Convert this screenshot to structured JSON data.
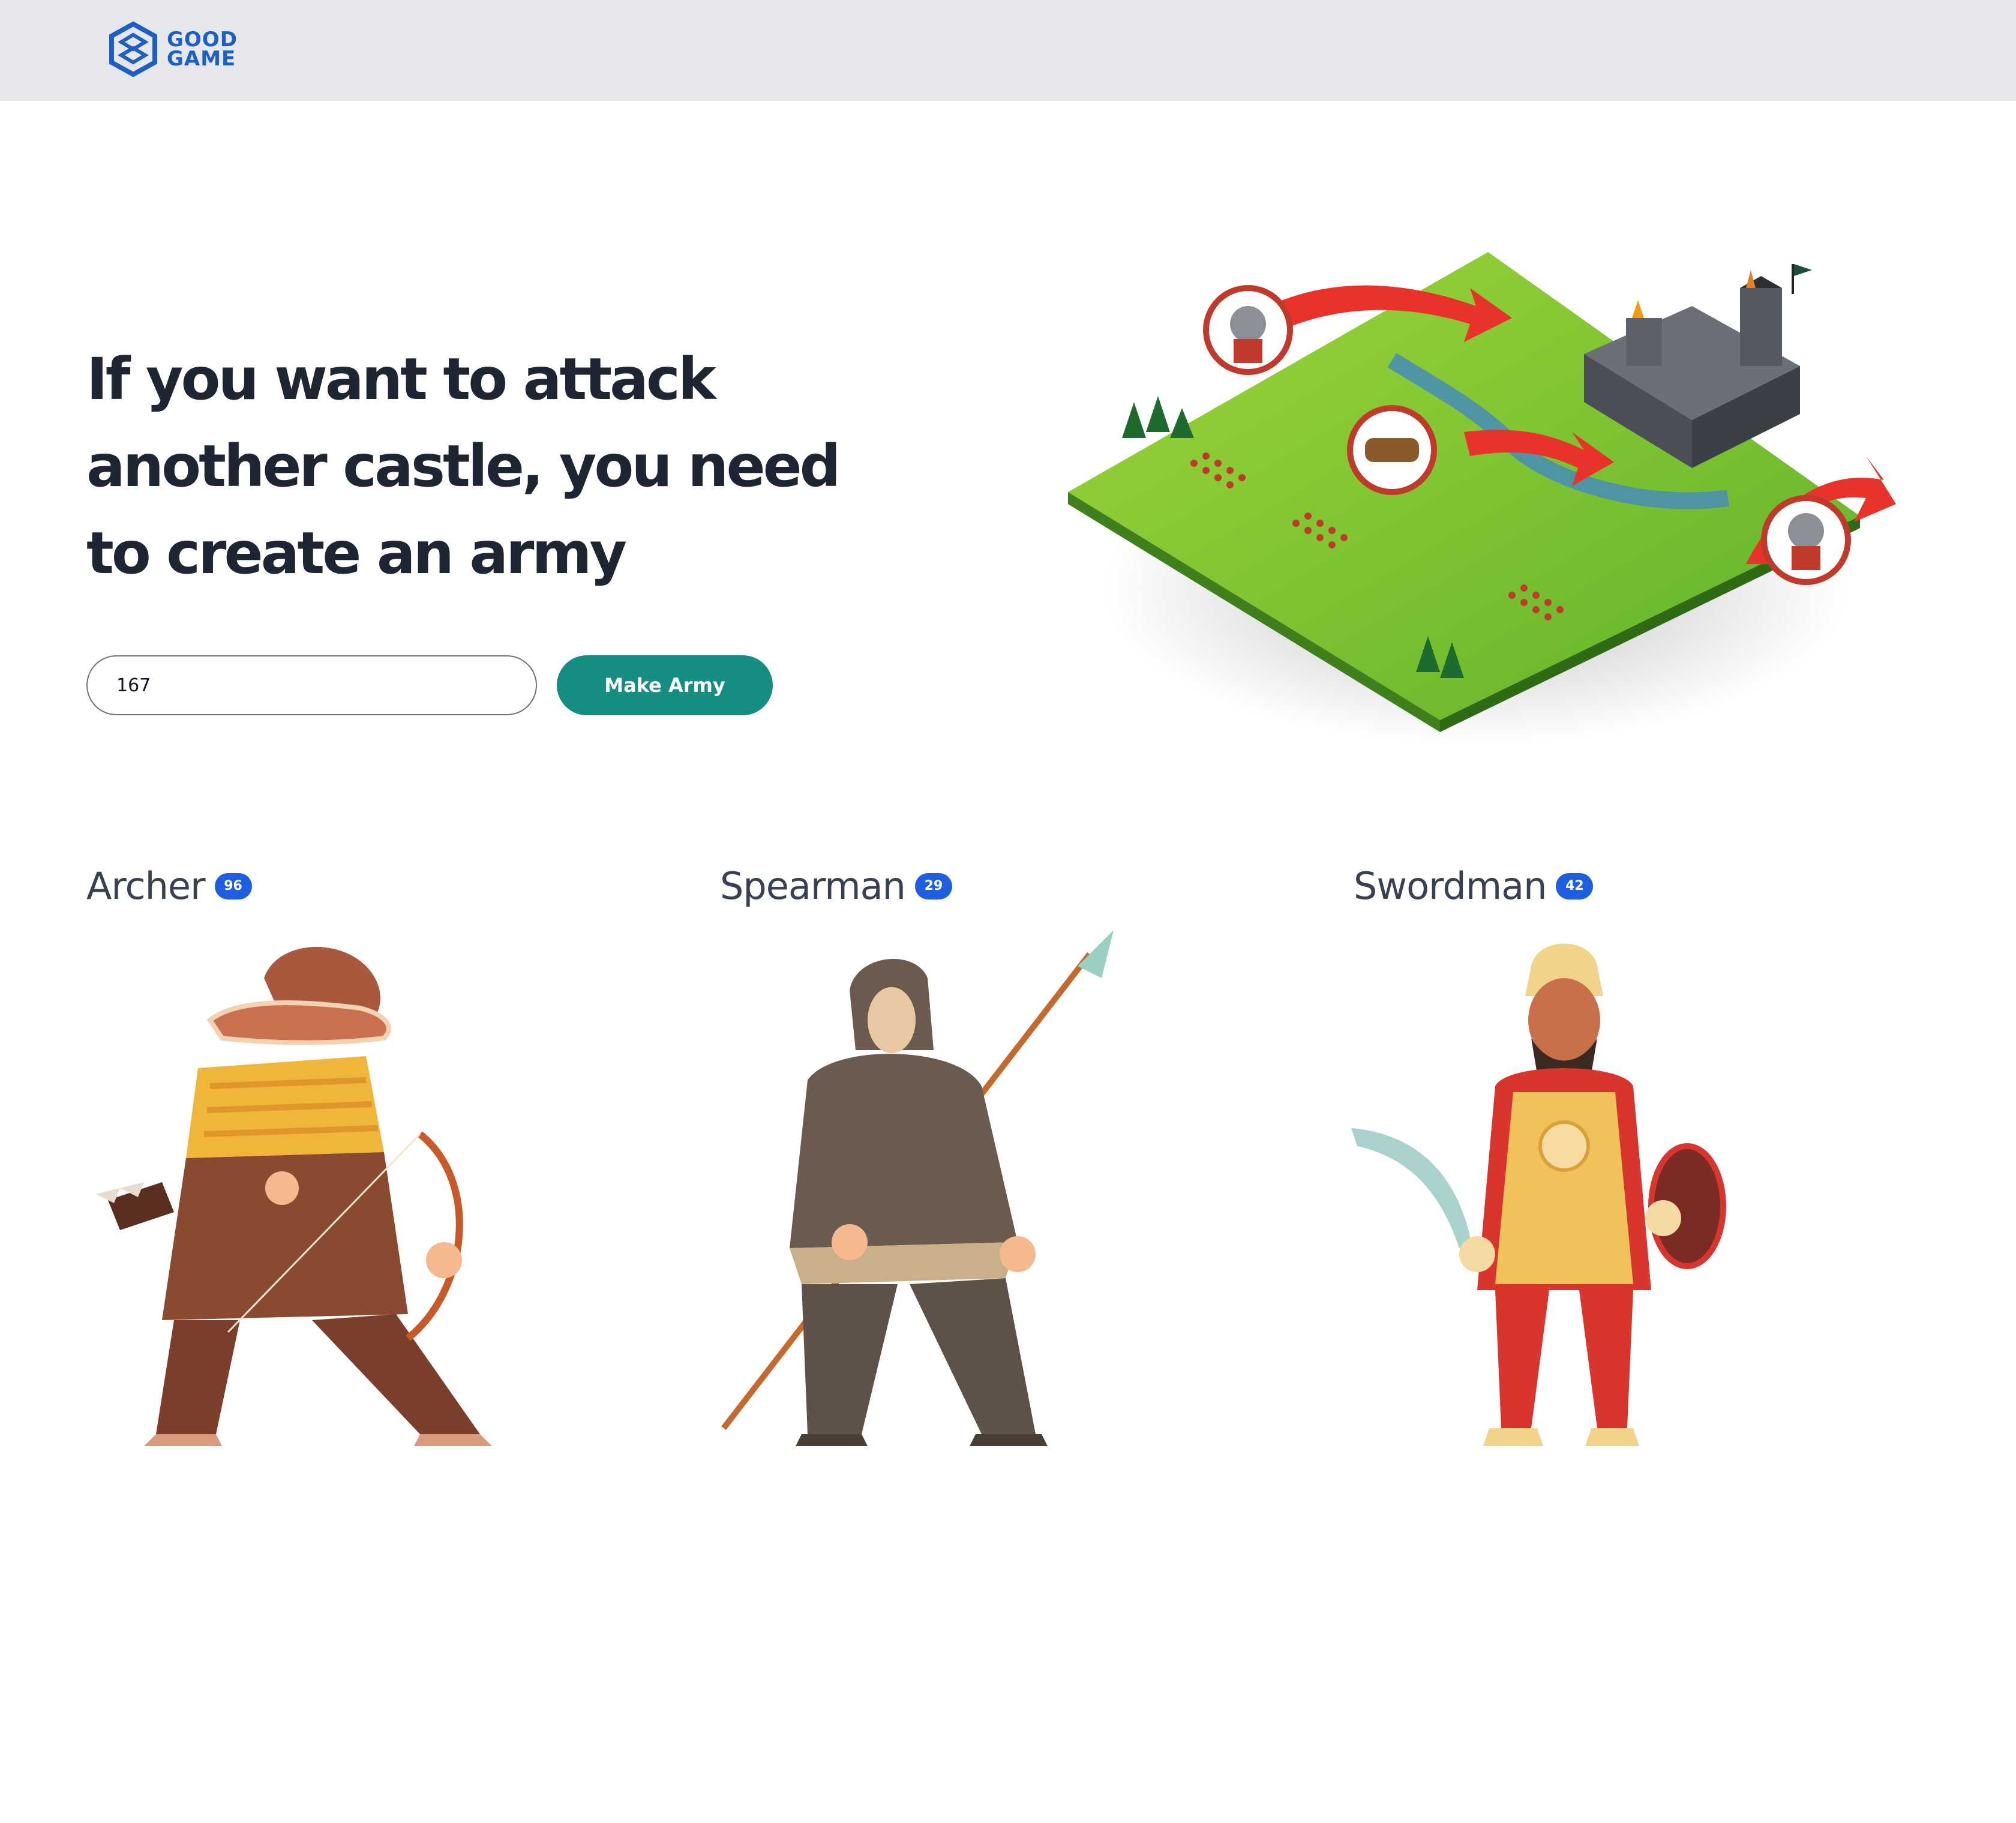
{
  "header": {
    "logo": {
      "line1": "GOOD",
      "line2": "GAME",
      "icon": "goodgame-hex-logo-icon",
      "color": "#1d5fc4"
    }
  },
  "hero": {
    "title_lines": [
      "If you want to attack",
      "another castle, you need",
      "to create an army"
    ],
    "input_value": "167",
    "button_label": "Make Army",
    "button_color": "#158d80",
    "illustration": "isometric-castle-siege-battlefield"
  },
  "units": [
    {
      "name": "Archer",
      "count": "96",
      "figure": "archer-figure"
    },
    {
      "name": "Spearman",
      "count": "29",
      "figure": "spearman-figure"
    },
    {
      "name": "Swordman",
      "count": "42",
      "figure": "swordman-figure"
    }
  ],
  "colors": {
    "badge": "#1d5fe0",
    "header_bg": "#e5e7eb",
    "title": "#1e2533"
  }
}
